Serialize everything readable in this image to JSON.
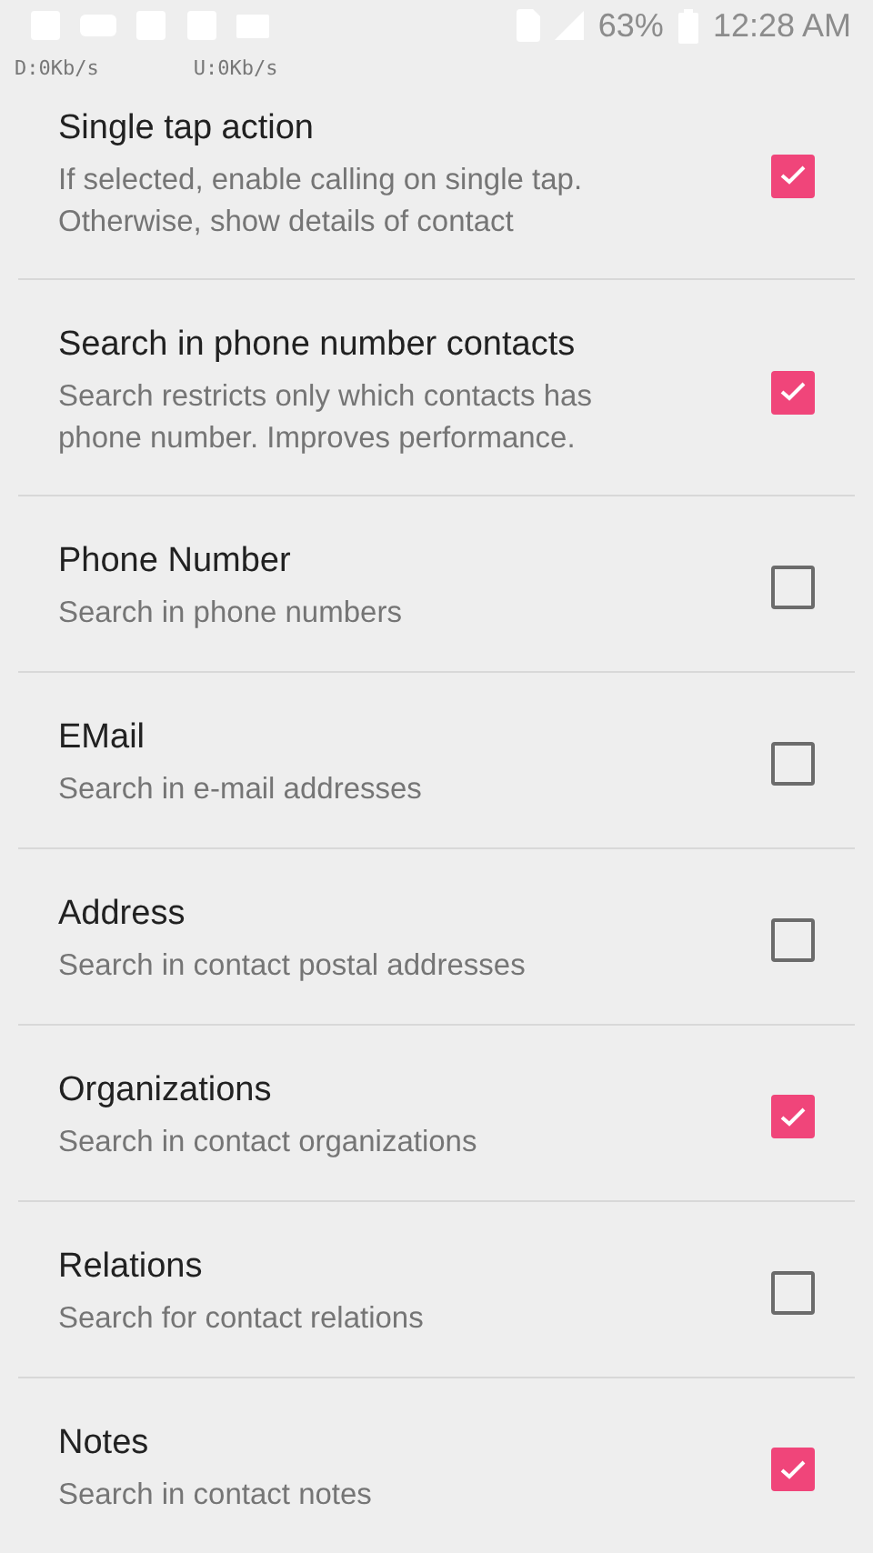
{
  "status_bar": {
    "battery": "63%",
    "time": "12:28 AM"
  },
  "speed": {
    "down": "D:0Kb/s",
    "up": "U:0Kb/s"
  },
  "settings": [
    {
      "title": "Single tap action",
      "summary": "If selected, enable calling on single tap.\nOtherwise, show details of contact",
      "checked": true
    },
    {
      "title": "Search in phone number contacts",
      "summary": "Search restricts only which contacts has\nphone number. Improves performance.",
      "checked": true
    },
    {
      "title": "Phone Number",
      "summary": "Search in phone numbers",
      "checked": false
    },
    {
      "title": "EMail",
      "summary": "Search in e-mail addresses",
      "checked": false
    },
    {
      "title": "Address",
      "summary": "Search in contact postal addresses",
      "checked": false
    },
    {
      "title": "Organizations",
      "summary": "Search in contact organizations",
      "checked": true
    },
    {
      "title": "Relations",
      "summary": "Search for contact relations",
      "checked": false
    },
    {
      "title": "Notes",
      "summary": "Search in contact notes",
      "checked": true
    }
  ]
}
